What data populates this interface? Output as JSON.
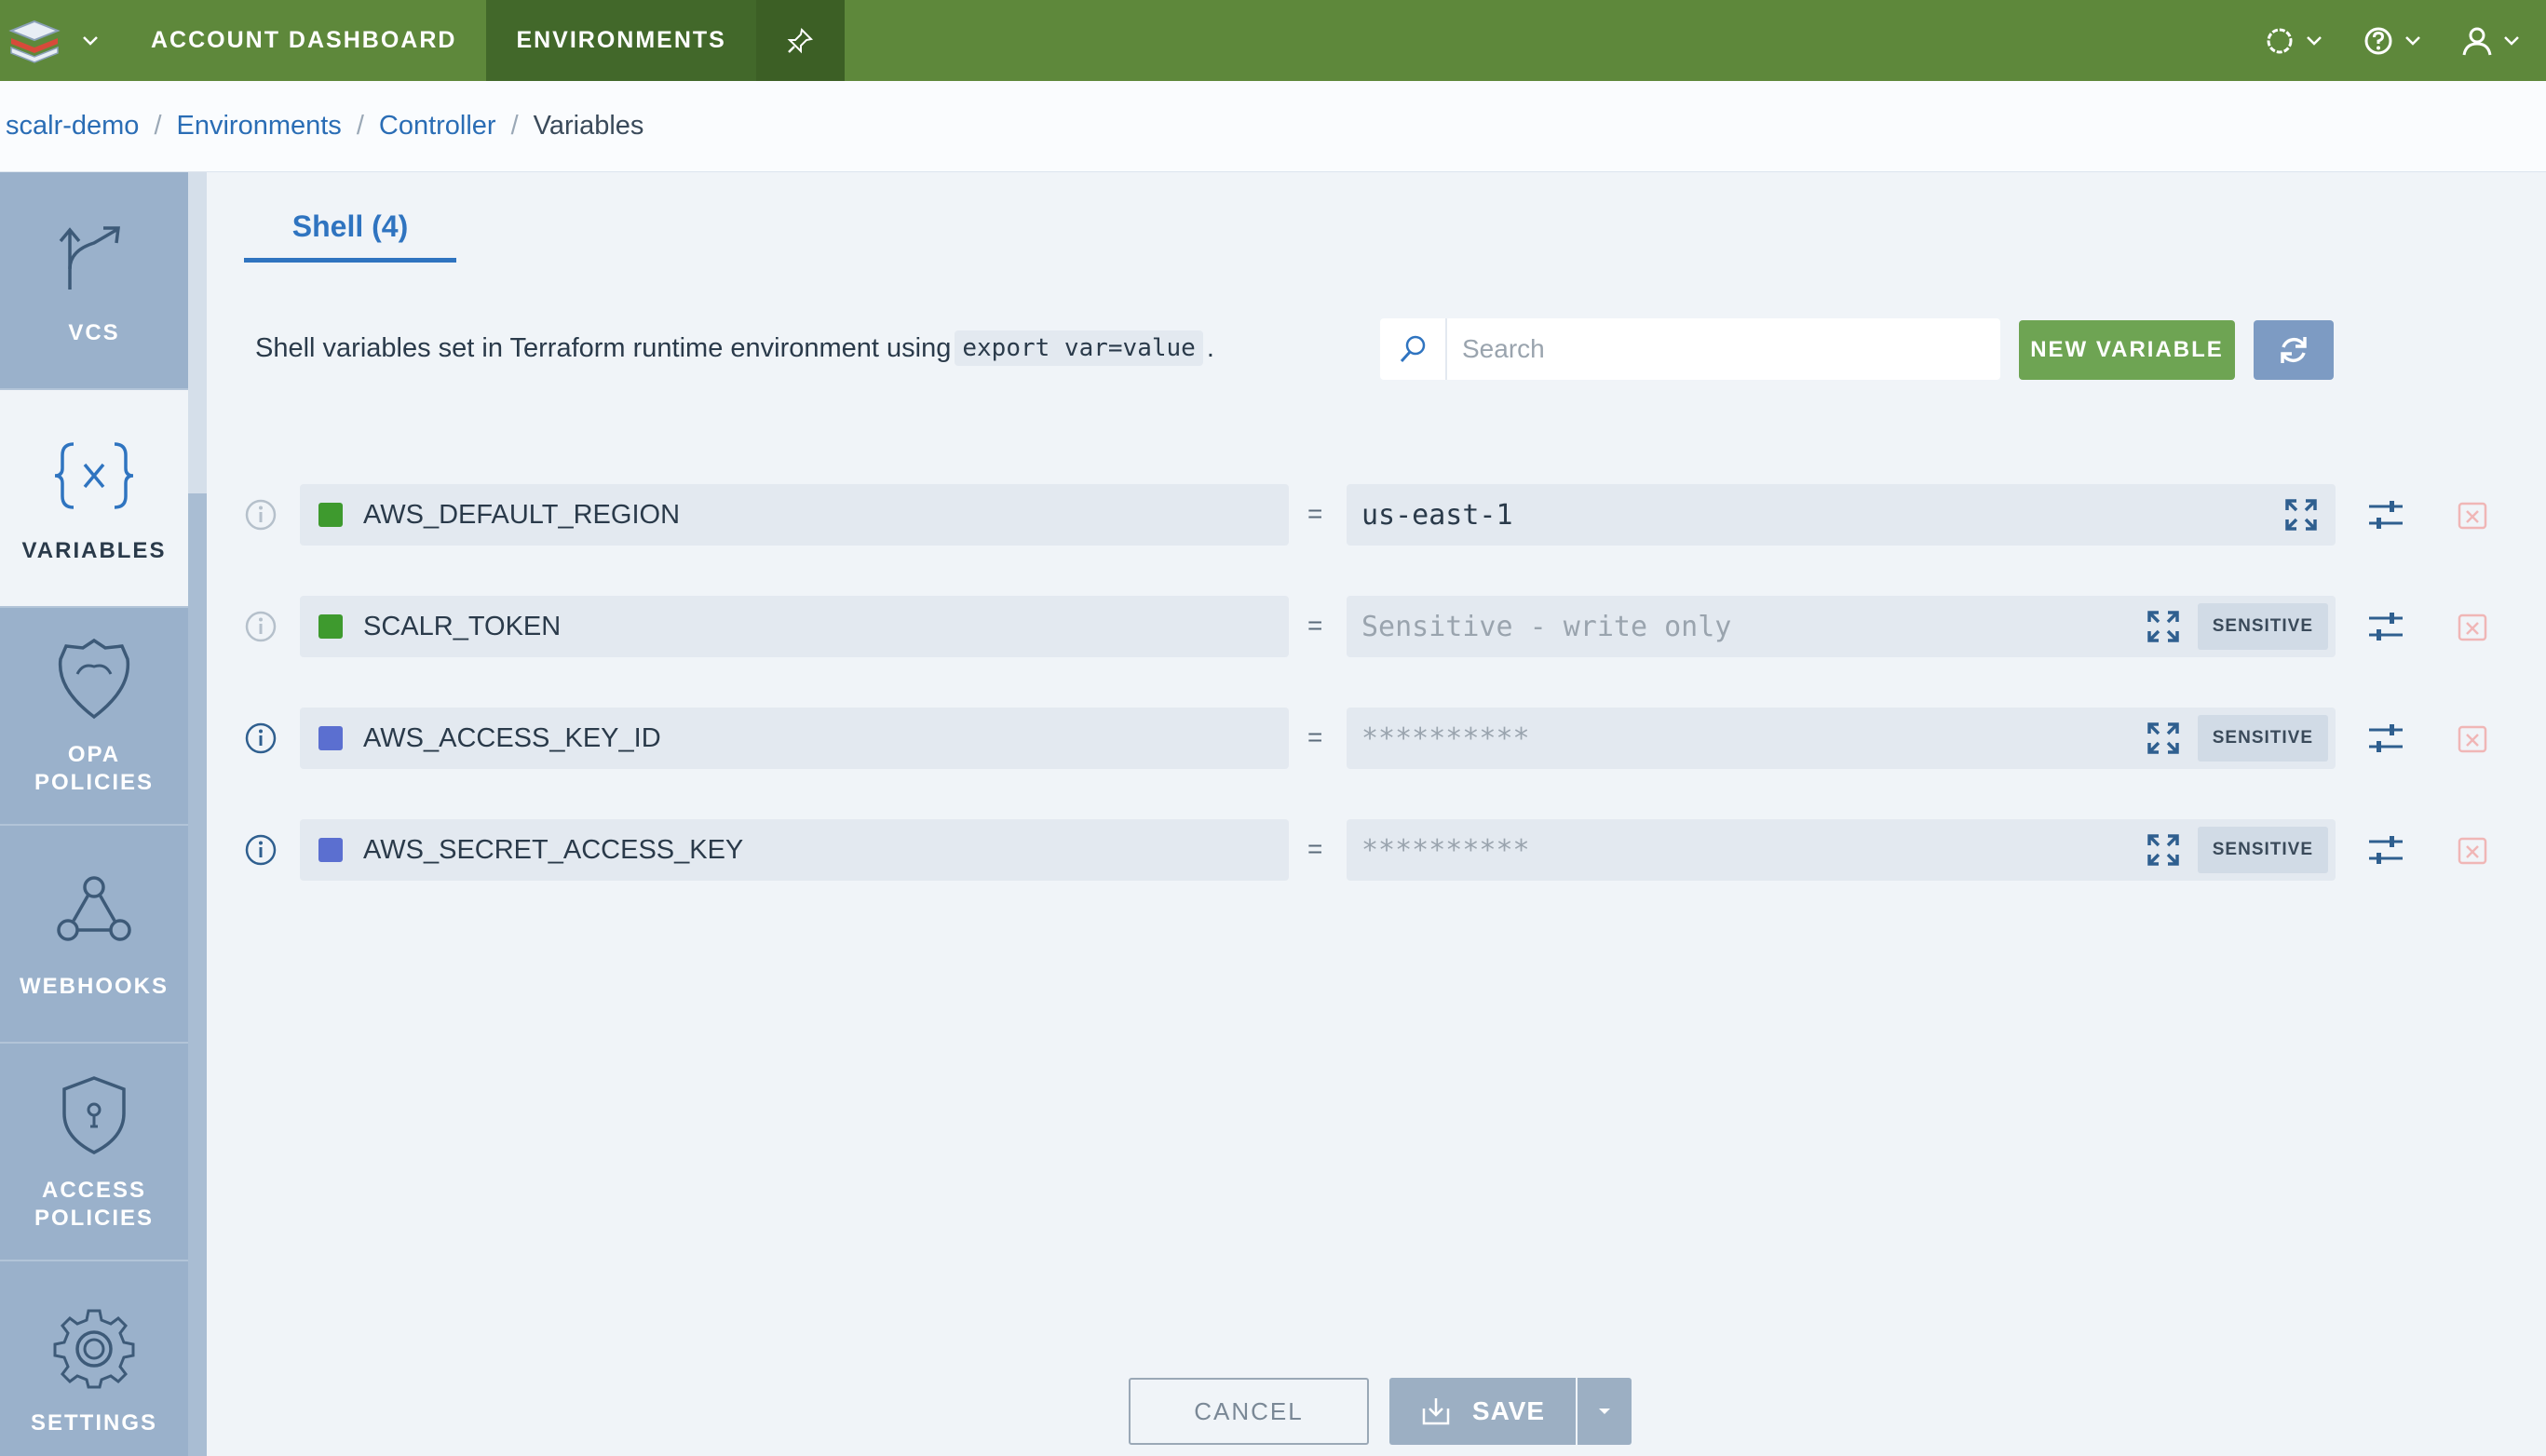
{
  "topbar": {
    "nav": [
      {
        "label": "ACCOUNT DASHBOARD"
      },
      {
        "label": "ENVIRONMENTS"
      }
    ],
    "logo_icon": "scalr-stack-logo",
    "pin_icon": "pin-icon",
    "accent": "#5e883b"
  },
  "breadcrumb": {
    "items": [
      "scalr-demo",
      "Environments",
      "Controller"
    ],
    "current": "Variables",
    "sep": "/"
  },
  "sidebar": {
    "items": [
      {
        "label": "VCS",
        "icon": "vcs-branch-icon"
      },
      {
        "label": "VARIABLES",
        "icon": "variables-braces-icon",
        "active": true
      },
      {
        "label": "OPA\nPOLICIES",
        "icon": "opa-policy-icon"
      },
      {
        "label": "WEBHOOKS",
        "icon": "webhook-icon"
      },
      {
        "label": "ACCESS\nPOLICIES",
        "icon": "access-shield-icon"
      },
      {
        "label": "SETTINGS",
        "icon": "gear-icon"
      }
    ]
  },
  "main": {
    "tab_label": "Shell (4)",
    "description_pre": "Shell variables set in Terraform runtime environment using",
    "description_code": "export var=value",
    "description_post": ".",
    "search_placeholder": "Search",
    "new_variable_label": "NEW VARIABLE",
    "variables": [
      {
        "key": "AWS_DEFAULT_REGION",
        "value": "us-east-1",
        "value_muted": false,
        "sensitive": false,
        "color": "#3e9a2e"
      },
      {
        "key": "SCALR_TOKEN",
        "value": "Sensitive - write only",
        "value_muted": true,
        "sensitive": true,
        "color": "#3e9a2e"
      },
      {
        "key": "AWS_ACCESS_KEY_ID",
        "value": "**********",
        "value_muted": true,
        "sensitive": true,
        "color": "#5b6fd0"
      },
      {
        "key": "AWS_SECRET_ACCESS_KEY",
        "value": "**********",
        "value_muted": true,
        "sensitive": true,
        "color": "#5b6fd0"
      }
    ],
    "sensitive_label": "SENSITIVE",
    "equals": "="
  },
  "footer": {
    "cancel_label": "CANCEL",
    "save_label": "SAVE"
  }
}
